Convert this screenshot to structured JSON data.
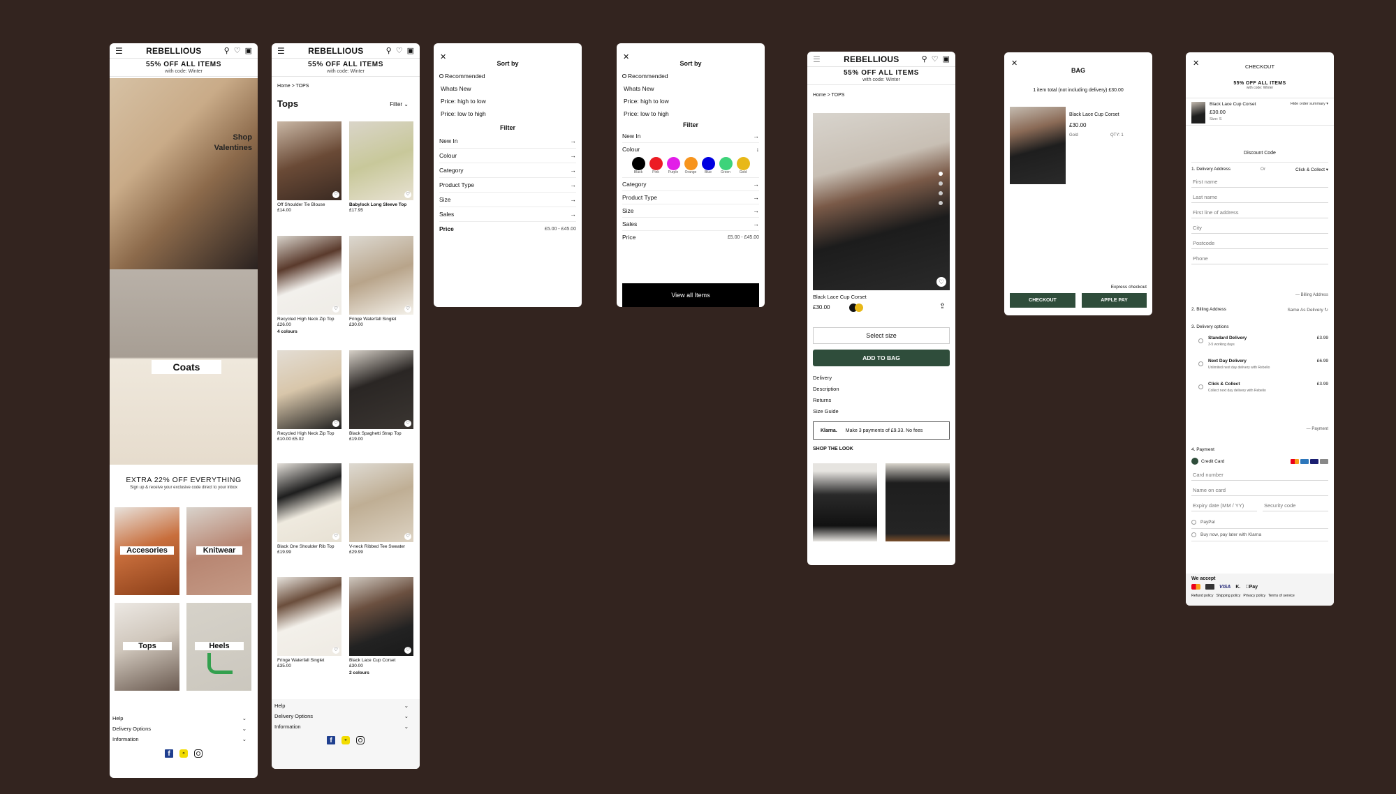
{
  "brand": "REBELLIOUS",
  "promo": {
    "line1": "55% OFF ALL ITEMS",
    "line2": "with code: Winter"
  },
  "home": {
    "hero_caption": "Shop Valentines",
    "coats": "Coats",
    "extra_title": "EXTRA 22% OFF EVERYTHING",
    "extra_sub": "Sign up & receive your exclusive code direct to your inbox",
    "categories": [
      "Accesories",
      "Knitwear",
      "Tops",
      "Heels"
    ]
  },
  "footer": {
    "items": [
      "Help",
      "Delivery Options",
      "Information"
    ]
  },
  "listing": {
    "breadcrumb": "Home > TOPS",
    "title": "Tops",
    "filter_label": "Filter",
    "products": [
      {
        "name": "Off Shoulder Tie Blouse",
        "price": "£14.00",
        "extra": ""
      },
      {
        "name": "Babylock Long Sleeve Top",
        "price": "£17.95",
        "extra": ""
      },
      {
        "name": "Recycled High Neck Zip Top",
        "price": "£26.00",
        "extra": "4 colours"
      },
      {
        "name": "Fringe Waterfall Singlet",
        "price": "£30.00",
        "extra": ""
      },
      {
        "name": "Recycled High Neck Zip Top",
        "price": "£10.00  £5.02",
        "extra": ""
      },
      {
        "name": "Black Spaghetti Strap Top",
        "price": "£19.00",
        "extra": ""
      },
      {
        "name": "Black One Shoulder Rib Top",
        "price": "£19.99",
        "extra": ""
      },
      {
        "name": "V-neck Ribbed Tee Sweater",
        "price": "£29.99",
        "extra": ""
      },
      {
        "name": "Fringe Waterfall Singlet",
        "price": "£35.00",
        "extra": ""
      },
      {
        "name": "Black Lace Cup Corset",
        "price": "£30.00",
        "extra": "2 colours"
      }
    ]
  },
  "sortfilter": {
    "sort_title": "Sort by",
    "sort_options": [
      "Recommended",
      "Whats New",
      "Price: high to low",
      "Price: low to high"
    ],
    "filter_title": "Filter",
    "filters": [
      "New In",
      "Colour",
      "Category",
      "Product Type",
      "Size",
      "Sales"
    ],
    "price_label": "Price",
    "price_range": "£5.00 - £45.00"
  },
  "sortfilter2": {
    "filters_before": [
      "New In",
      "Colour"
    ],
    "filters_after": [
      "Category",
      "Product Type",
      "Size",
      "Sales"
    ],
    "colours": [
      {
        "name": "Black",
        "hex": "#000000"
      },
      {
        "name": "Pink",
        "hex": "#ec1c24"
      },
      {
        "name": "Purple",
        "hex": "#e21ee8"
      },
      {
        "name": "Orange",
        "hex": "#f7941d"
      },
      {
        "name": "Blue",
        "hex": "#0000e0"
      },
      {
        "name": "Green",
        "hex": "#3ed37a"
      },
      {
        "name": "Gold",
        "hex": "#e8b818"
      }
    ],
    "view_all": "View all Items"
  },
  "product": {
    "breadcrumb": "Home > TOPS",
    "name": "Black Lace Cup Corset",
    "price": "£30.00",
    "select_size": "Select size",
    "add_to_bag": "ADD TO BAG",
    "links": [
      "Delivery",
      "Description",
      "Returns",
      "Size Guide"
    ],
    "klarna_brand": "Klarna.",
    "klarna_text": "Make 3 payments of £9.33. No fees",
    "shop_the_look": "SHOP THE LOOK"
  },
  "bag": {
    "title": "BAG",
    "summary": "1 item total (not including delivery) £30.00",
    "item_name": "Black Lace Cup Corset",
    "item_price": "£30.00",
    "item_size": "Gold",
    "item_qty": "QTY: 1",
    "express": "Express checkout",
    "checkout": "CHECKOUT",
    "applepay": "APPLE PAY"
  },
  "checkout": {
    "title": "CHECKOUT",
    "item_name": "Black Lace Cup Corset",
    "item_price": "£30.00",
    "item_size": "Size: S",
    "item_change": "Hide order summary",
    "discount": "Discount Code",
    "delivery_address": "1. Delivery Address",
    "or": "Or",
    "click_collect": "Click & Collect",
    "fields": [
      "First name",
      "Last name",
      "First line of address",
      "City",
      "Postcode",
      "Phone"
    ],
    "billing_link": "Billing Address",
    "billing_title": "2. Billing Address",
    "same_as": "Same As Delivery",
    "delivery_title": "3. Delivery options",
    "options": [
      {
        "name": "Standard Delivery",
        "desc": "3-5 working days",
        "price": "£3.99"
      },
      {
        "name": "Next Day Delivery",
        "desc": "Unlimited next day delivery with Rebelio",
        "price": "£6.99"
      },
      {
        "name": "Click & Collect",
        "desc": "Collect next day delivery with Rebelio",
        "price": "£3.99"
      }
    ],
    "payment_link": "Payment",
    "payment_title": "4. Payment",
    "credit_card": "Credit Card",
    "card_fields": [
      "Card number",
      "Name on card",
      "Expiry date (MM / YY)",
      "Security code"
    ],
    "paypal": "PayPal",
    "klarna": "Buy now, pay later with Klarna",
    "we_accept": "We accept",
    "footer_links": [
      "Refund policy",
      "Shipping policy",
      "Privacy policy",
      "Terms of service"
    ]
  },
  "colors": {
    "background": "#33241f",
    "accent": "#2f4d3b"
  },
  "icons": [
    "menu-icon",
    "search-icon",
    "heart-icon",
    "bag-icon",
    "close-icon",
    "arrow-right-icon",
    "chevron-down-icon",
    "share-icon"
  ]
}
